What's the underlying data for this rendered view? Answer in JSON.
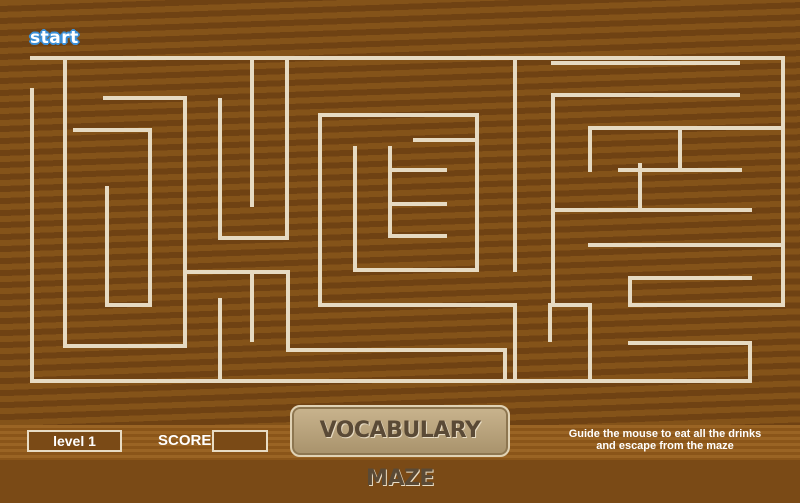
{
  "game": {
    "start_label": "start",
    "level_label": "level 1",
    "score_label": "SCORE",
    "score_value": "",
    "title": "VOCABULARY MAZE",
    "instructions_line1": "Guide the mouse to eat all the drinks",
    "instructions_line2": "and escape from the maze"
  },
  "colors": {
    "background_dark": "#6f4213",
    "background_light": "#845319",
    "maze_wall": "#e6dac2",
    "start_outline": "#3a8fd8",
    "title_badge": "#b8a27b"
  }
}
